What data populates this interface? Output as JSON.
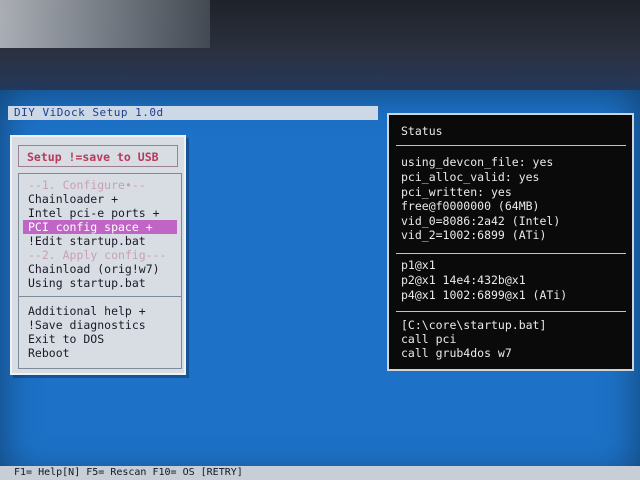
{
  "window": {
    "title": "DIY ViDock Setup 1.0d"
  },
  "menu": {
    "header": "Setup !=save to USB",
    "sections": [
      {
        "label": "1. Configure"
      },
      {
        "label": "2. Apply config"
      }
    ],
    "items": [
      {
        "label": "Chainloader +"
      },
      {
        "label": "Intel pci-e ports +"
      },
      {
        "label": "PCI config space +",
        "selected": true
      },
      {
        "label": "!Edit startup.bat"
      },
      {
        "label": "Chainload (orig!w7)"
      },
      {
        "label": "Using startup.bat"
      },
      {
        "label": "Additional help +"
      },
      {
        "label": "!Save diagnostics"
      },
      {
        "label": "Exit to DOS"
      },
      {
        "label": "Reboot"
      }
    ]
  },
  "status": {
    "title": "Status",
    "block1": [
      "using_devcon_file: yes",
      "pci_alloc_valid: yes",
      "pci_written: yes",
      "free@f0000000 (64MB)",
      "vid_0=8086:2a42 (Intel)",
      "vid_2=1002:6899 (ATi)"
    ],
    "block2": [
      "p1@x1",
      "p2@x1 14e4:432b@x1",
      "p4@x1 1002:6899@x1 (ATi)"
    ],
    "block3": [
      "[C:\\core\\startup.bat]",
      "call pci",
      "call grub4dos w7"
    ]
  },
  "footer": {
    "text": "F1= Help[N]  F5= Rescan  F10= OS [RETRY]"
  },
  "colors": {
    "screen_background": "#1d72c7",
    "menu_selected": "#c064c5",
    "menu_header": "#b83a5a",
    "status_background": "#0a0a0a"
  }
}
